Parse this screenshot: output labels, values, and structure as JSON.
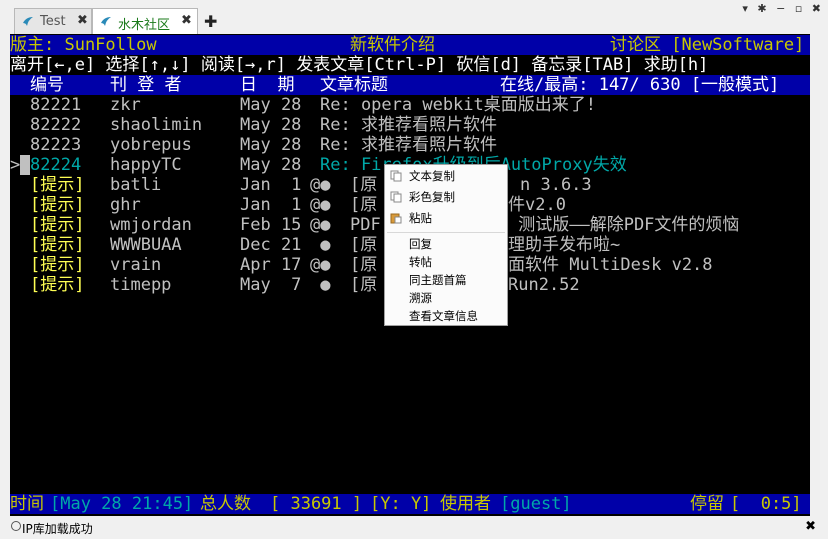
{
  "tabs": [
    {
      "label": "Test",
      "close": "✖"
    },
    {
      "label": "水木社区",
      "close": "✖"
    }
  ],
  "tab_add": "✚",
  "window_controls": "▾ ✱ − ▫ ✖",
  "header": {
    "moderator": "版主: SunFollow",
    "board_desc": "新软件介绍",
    "board_name": "讨论区 [NewSoftware]"
  },
  "help_line": "离开[←,e] 选择[↑,↓] 阅读[→,r] 发表文章[Ctrl-P] 砍信[d] 备忘录[TAB] 求助[h]",
  "columns": {
    "num": "编号",
    "author": "刊 登 者",
    "date": "日  期",
    "title": "文章标题",
    "online": "在线/最高: 147/ 630 [一般模式]"
  },
  "posts": [
    {
      "num": "82221",
      "author": "zkr",
      "date": "May 28",
      "flag": "",
      "title": "Re: opera webkit桌面版出来了!"
    },
    {
      "num": "82222",
      "author": "shaolimin",
      "date": "May 28",
      "flag": "",
      "title": "Re: 求推荐看照片软件"
    },
    {
      "num": "82223",
      "author": "yobrepus",
      "date": "May 28",
      "flag": "",
      "title": "Re: 求推荐看照片软件"
    },
    {
      "num": "82224",
      "author": "happyTC",
      "date": "May 28",
      "flag": "",
      "title": "Re: Firefox升级到后AutoProxy失效"
    },
    {
      "num": "[提示]",
      "author": "batli",
      "date": "Jan  1",
      "flag": "@●",
      "title": "[原",
      "tail": "n 3.6.3"
    },
    {
      "num": "[提示]",
      "author": "ghr",
      "date": "Jan  1",
      "flag": "@●",
      "title": "[原",
      "tail": "件v2.0"
    },
    {
      "num": "[提示]",
      "author": "wmjordan",
      "date": "Feb 15",
      "flag": "@●",
      "title": "PDF",
      "tail": " 测试版——解除PDF文件的烦恼"
    },
    {
      "num": "[提示]",
      "author": "WWWBUAA",
      "date": "Dec 21",
      "flag": " ●",
      "title": "[原",
      "tail": "理助手发布啦~"
    },
    {
      "num": "[提示]",
      "author": "vrain",
      "date": "Apr 17",
      "flag": "@●",
      "title": "[原",
      "tail": "面软件 MultiDesk v2.8"
    },
    {
      "num": "[提示]",
      "author": "timepp",
      "date": "May  7",
      "flag": " ●",
      "title": "[原",
      "tail": "Run2.52"
    }
  ],
  "selected_marker": ">",
  "footer": {
    "time_label": "时间",
    "time_value": "[May 28 21:45]",
    "total_label": "总人数",
    "total_value": "[ 33691 ]",
    "yy": "[Y: Y]",
    "user_label": "使用者",
    "user_value": "[guest]",
    "stay_label": "停留",
    "stay_value": "[  0:5]"
  },
  "context_menu": {
    "items": [
      {
        "label": "文本复制",
        "icon": "copy-text-icon"
      },
      {
        "label": "彩色复制",
        "icon": "copy-color-icon"
      },
      {
        "label": "粘贴",
        "icon": "paste-icon"
      },
      {
        "label": "回复",
        "icon": ""
      },
      {
        "label": "转帖",
        "icon": ""
      },
      {
        "label": "同主题首篇",
        "icon": ""
      },
      {
        "label": "溯源",
        "icon": ""
      },
      {
        "label": "查看文章信息",
        "icon": ""
      }
    ]
  },
  "status": {
    "text": "IP库加载成功",
    "close": "✖"
  },
  "colors": {
    "terminal_bg": "#000000",
    "bar_blue": "#0000a8",
    "tab_active_text": "#1a7a1a"
  }
}
